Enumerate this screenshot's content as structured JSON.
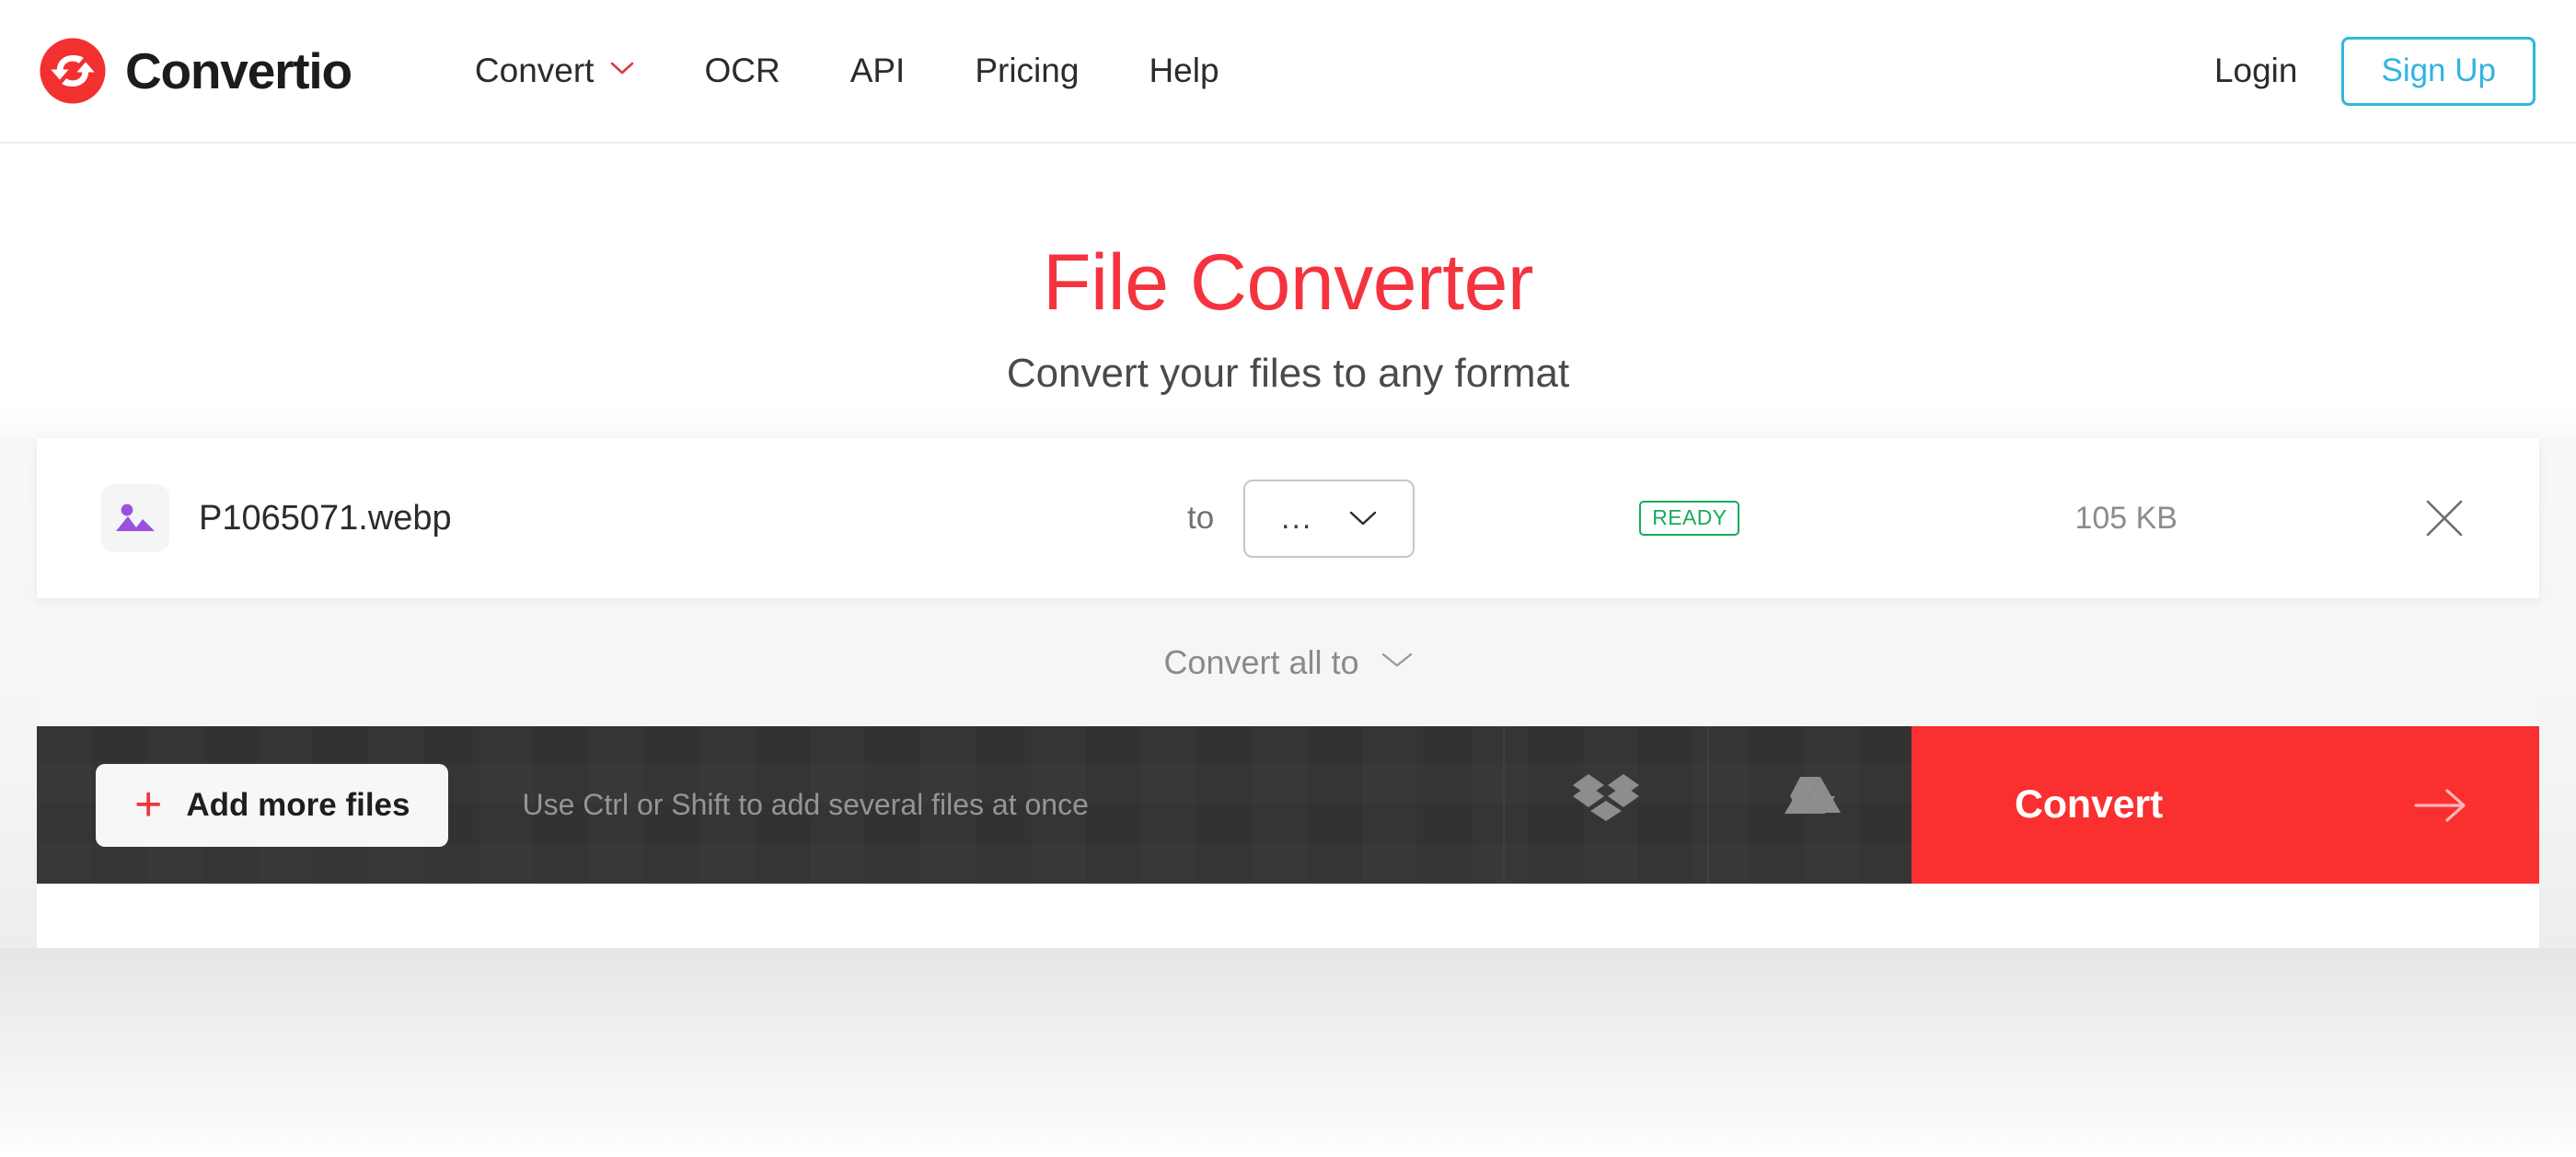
{
  "header": {
    "brand": "Convertio",
    "logo_icon": "convertio-cycle-logo",
    "nav": [
      {
        "label": "Convert",
        "has_dropdown": true,
        "icon": "chevron-down-icon"
      },
      {
        "label": "OCR",
        "has_dropdown": false
      },
      {
        "label": "API",
        "has_dropdown": false
      },
      {
        "label": "Pricing",
        "has_dropdown": false
      },
      {
        "label": "Help",
        "has_dropdown": false
      }
    ],
    "login_label": "Login",
    "signup_label": "Sign Up"
  },
  "hero": {
    "title": "File Converter",
    "subtitle": "Convert your files to any format"
  },
  "file_row": {
    "file_icon": "image-file-icon",
    "file_name": "P1065071.webp",
    "to_label": "to",
    "format_value": "...",
    "format_chevron_icon": "chevron-down-icon",
    "status": "READY",
    "file_size": "105 KB",
    "remove_icon": "close-icon"
  },
  "convert_all": {
    "label": "Convert all to",
    "icon": "chevron-down-icon"
  },
  "action_bar": {
    "add_more_label": "Add more files",
    "add_more_icon": "plus-icon",
    "hint": "Use Ctrl or Shift to add several files at once",
    "dropbox_icon": "dropbox-icon",
    "google_drive_icon": "google-drive-icon",
    "convert_label": "Convert",
    "convert_arrow_icon": "arrow-right-icon"
  },
  "colors": {
    "brand_red": "#f5333f",
    "convert_red": "#fa2f2f",
    "signup_blue": "#31b4df",
    "ready_green": "#17ab5a",
    "dark_bar": "#343434",
    "file_icon_purple": "#9b51e0"
  }
}
